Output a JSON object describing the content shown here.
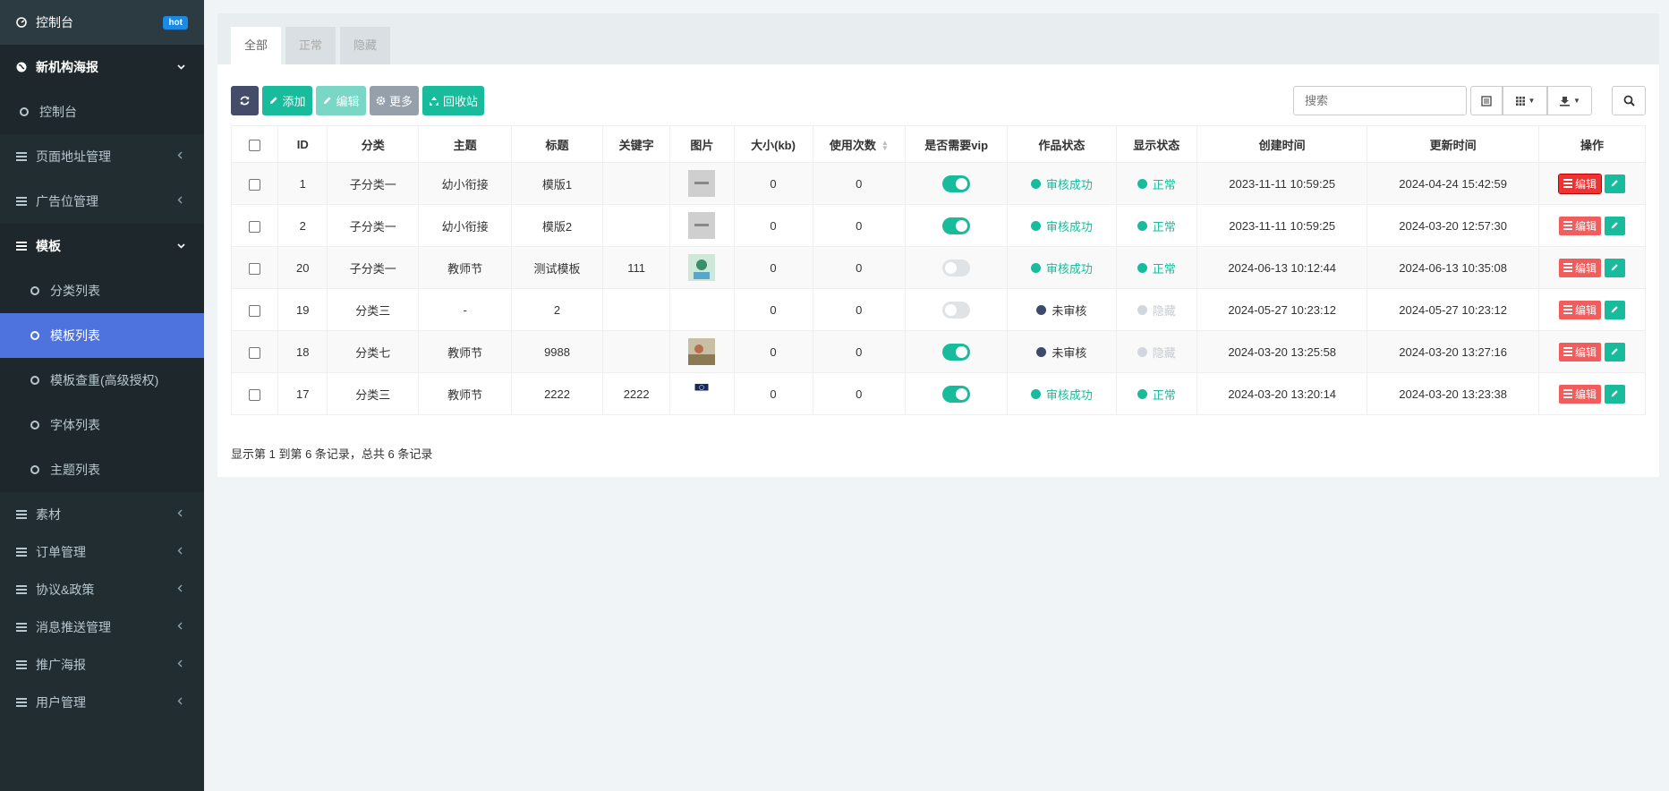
{
  "sidebar": {
    "items": [
      {
        "label": "控制台",
        "badge": "hot",
        "icon": "dashboard-icon"
      },
      {
        "label": "新机构海报",
        "icon": "globe-icon",
        "expanded": true
      },
      {
        "label": "控制台",
        "icon": "circle-icon"
      },
      {
        "label": "页面地址管理",
        "icon": "list-icon"
      },
      {
        "label": "广告位管理",
        "icon": "list-icon"
      },
      {
        "label": "模板",
        "icon": "list-icon",
        "expanded": true
      },
      {
        "label": "分类列表",
        "icon": "circle-icon"
      },
      {
        "label": "模板列表",
        "icon": "circle-icon",
        "active": true
      },
      {
        "label": "模板查重(高级授权)",
        "icon": "circle-icon"
      },
      {
        "label": "字体列表",
        "icon": "circle-icon"
      },
      {
        "label": "主题列表",
        "icon": "circle-icon"
      },
      {
        "label": "素材",
        "icon": "list-icon"
      },
      {
        "label": "订单管理",
        "icon": "list-icon"
      },
      {
        "label": "协议&政策",
        "icon": "list-icon"
      },
      {
        "label": "消息推送管理",
        "icon": "list-icon"
      },
      {
        "label": "推广海报",
        "icon": "list-icon"
      },
      {
        "label": "用户管理",
        "icon": "list-icon"
      }
    ]
  },
  "tabs": [
    "全部",
    "正常",
    "隐藏"
  ],
  "toolbar": {
    "add": "添加",
    "edit": "编辑",
    "more": "更多",
    "recycle": "回收站",
    "search_placeholder": "搜索"
  },
  "table": {
    "headers": [
      "ID",
      "分类",
      "主题",
      "标题",
      "关键字",
      "图片",
      "大小(kb)",
      "使用次数",
      "是否需要vip",
      "作品状态",
      "显示状态",
      "创建时间",
      "更新时间",
      "操作"
    ],
    "edit_label": "编辑",
    "rows": [
      {
        "id": "1",
        "category": "子分类一",
        "theme": "幼小衔接",
        "title": "模版1",
        "keyword": "",
        "image": "gray",
        "size": "0",
        "uses": "0",
        "vip": true,
        "work_status": "审核成功",
        "display_status": "正常",
        "created": "2023-11-11 10:59:25",
        "updated": "2024-04-24 15:42:59"
      },
      {
        "id": "2",
        "category": "子分类一",
        "theme": "幼小衔接",
        "title": "模版2",
        "keyword": "",
        "image": "gray",
        "size": "0",
        "uses": "0",
        "vip": true,
        "work_status": "审核成功",
        "display_status": "正常",
        "created": "2023-11-11 10:59:25",
        "updated": "2024-03-20 12:57:30"
      },
      {
        "id": "20",
        "category": "子分类一",
        "theme": "教师节",
        "title": "测试模板",
        "keyword": "111",
        "image": "teal",
        "size": "0",
        "uses": "0",
        "vip": false,
        "work_status": "审核成功",
        "display_status": "正常",
        "created": "2024-06-13 10:12:44",
        "updated": "2024-06-13 10:35:08"
      },
      {
        "id": "19",
        "category": "分类三",
        "theme": "-",
        "title": "2",
        "keyword": "",
        "image": "none",
        "size": "0",
        "uses": "0",
        "vip": false,
        "work_status": "未审核",
        "display_status": "隐藏",
        "created": "2024-05-27 10:23:12",
        "updated": "2024-05-27 10:23:12"
      },
      {
        "id": "18",
        "category": "分类七",
        "theme": "教师节",
        "title": "9988",
        "keyword": "",
        "image": "brown",
        "size": "0",
        "uses": "0",
        "vip": true,
        "work_status": "未审核",
        "display_status": "隐藏",
        "created": "2024-03-20 13:25:58",
        "updated": "2024-03-20 13:27:16"
      },
      {
        "id": "17",
        "category": "分类三",
        "theme": "教师节",
        "title": "2222",
        "keyword": "2222",
        "image": "navy",
        "size": "0",
        "uses": "0",
        "vip": true,
        "work_status": "审核成功",
        "display_status": "正常",
        "created": "2024-03-20 13:20:14",
        "updated": "2024-03-20 13:23:38"
      }
    ]
  },
  "footer": "显示第 1 到第 6 条记录，总共 6 条记录",
  "colors": {
    "success": "#18bc9c",
    "pending": "#3c4a6b",
    "hidden": "#d2d6de",
    "sidebar": "#222d32",
    "active": "#4e73df",
    "edit": "#f15d5d"
  }
}
